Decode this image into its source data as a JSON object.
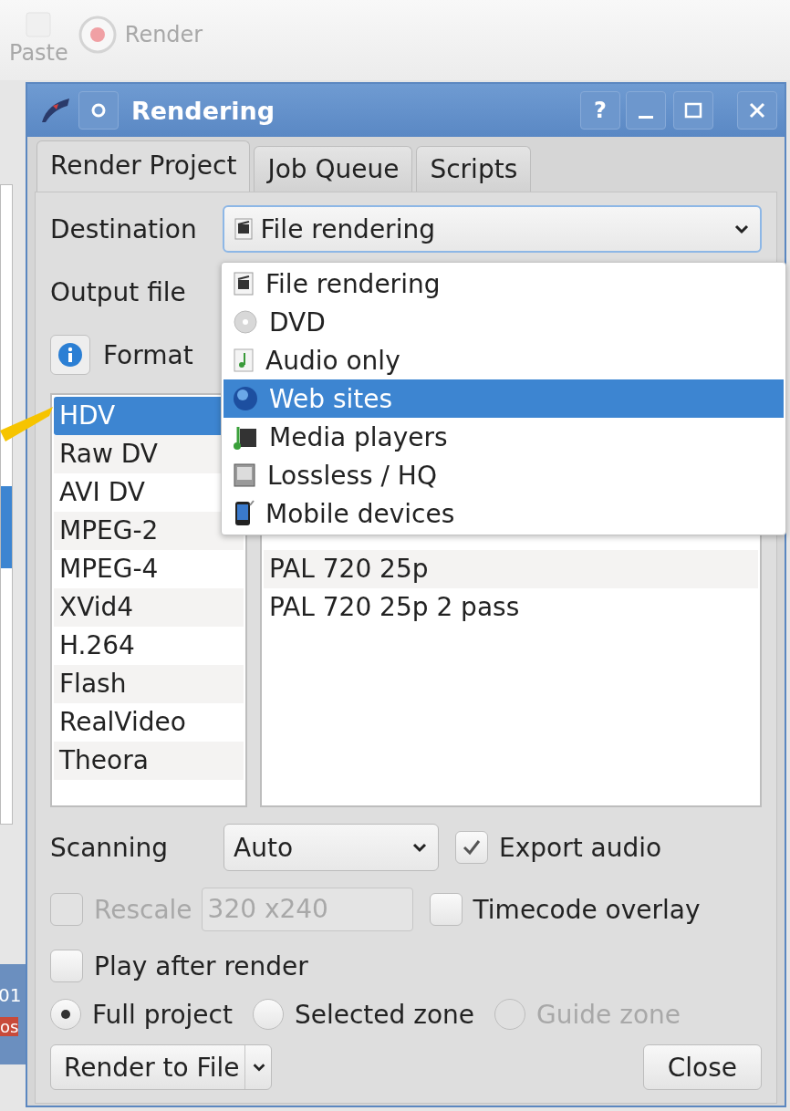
{
  "toolbar": {
    "paste": "Paste",
    "render": "Render"
  },
  "background": {
    "clip_number": "01",
    "clip_text": "os"
  },
  "dialog": {
    "title": "Rendering",
    "help": "?",
    "tabs": [
      {
        "label": "Render Project",
        "selected": true
      },
      {
        "label": "Job Queue",
        "selected": false
      },
      {
        "label": "Scripts",
        "selected": false
      }
    ],
    "destination": {
      "label": "Destination",
      "value": "File rendering"
    },
    "output_file": {
      "label": "Output file"
    },
    "format": {
      "label": "Format"
    },
    "destination_menu": [
      {
        "label": "File rendering",
        "kind": "clapper",
        "selected": false
      },
      {
        "label": "DVD",
        "kind": "disc",
        "selected": false
      },
      {
        "label": "Audio only",
        "kind": "audio",
        "selected": false
      },
      {
        "label": "Web sites",
        "kind": "globe",
        "selected": true
      },
      {
        "label": "Media players",
        "kind": "player",
        "selected": false
      },
      {
        "label": "Lossless / HQ",
        "kind": "drive",
        "selected": false
      },
      {
        "label": "Mobile devices",
        "kind": "phone",
        "selected": false
      }
    ],
    "formats": [
      {
        "label": "HDV",
        "selected": true
      },
      {
        "label": "Raw DV",
        "selected": false
      },
      {
        "label": "AVI DV",
        "selected": false
      },
      {
        "label": "MPEG-2",
        "selected": false
      },
      {
        "label": "MPEG-4",
        "selected": false
      },
      {
        "label": "XVid4",
        "selected": false
      },
      {
        "label": "H.264",
        "selected": false
      },
      {
        "label": "Flash",
        "selected": false
      },
      {
        "label": "RealVideo",
        "selected": false
      },
      {
        "label": "Theora",
        "selected": false
      }
    ],
    "presets": [
      "PAL 720 25p",
      "PAL 720 25p 2 pass"
    ],
    "scanning": {
      "label": "Scanning",
      "value": "Auto"
    },
    "export_audio": {
      "label": "Export audio",
      "checked": true,
      "disabled": false
    },
    "rescale": {
      "label": "Rescale",
      "checked": false,
      "disabled": true,
      "value": "320 x240"
    },
    "timecode_overlay": {
      "label": "Timecode overlay",
      "checked": false,
      "disabled": false
    },
    "play_after_render": {
      "label": "Play after render",
      "checked": false,
      "disabled": false
    },
    "zones": [
      {
        "label": "Full project",
        "selected": true,
        "disabled": false
      },
      {
        "label": "Selected zone",
        "selected": false,
        "disabled": false
      },
      {
        "label": "Guide zone",
        "selected": false,
        "disabled": true
      }
    ],
    "render_button": "Render to File",
    "close_button": "Close"
  }
}
